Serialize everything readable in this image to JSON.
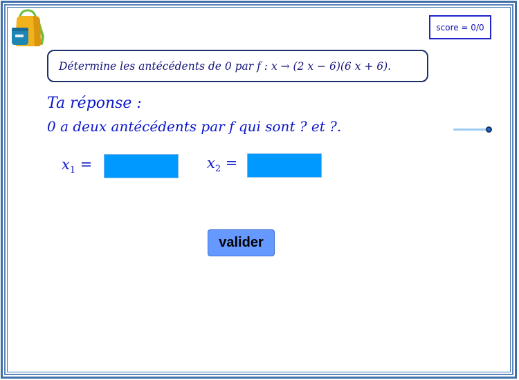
{
  "score": {
    "label": "score = 0/0"
  },
  "question": {
    "text": "Détermine les antécédents de 0 par f : x → (2 x − 6)(6 x + 6)."
  },
  "answer": {
    "line1": "Ta réponse :",
    "line2": "0 a deux antécédents par f qui sont ? et ?."
  },
  "inputs": {
    "x1": {
      "label": "x",
      "sub": "1",
      "eq": " =",
      "value": ""
    },
    "x2": {
      "label": "x",
      "sub": "2",
      "eq": " =",
      "value": ""
    }
  },
  "buttons": {
    "validate_label": "valider"
  },
  "icons": {
    "app": "backpack-icon",
    "slider": "slider-knob"
  },
  "colors": {
    "frame": "#3f6fa8",
    "text_blue": "#0b17c9",
    "field_fill": "#0099ff",
    "button_fill": "#6699ff",
    "score_border": "#1f24c7"
  }
}
